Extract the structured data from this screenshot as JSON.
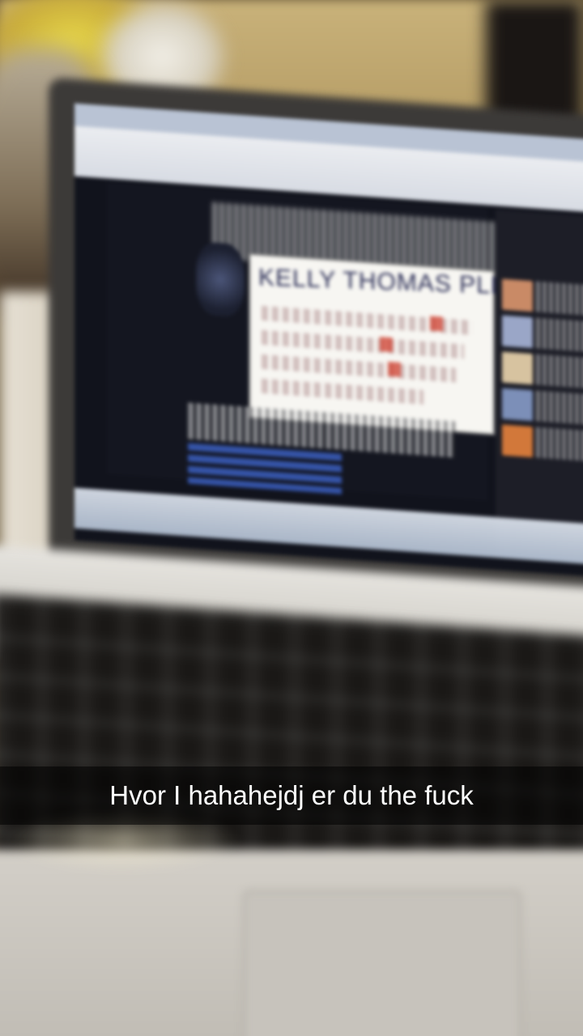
{
  "caption": {
    "text": "Hvor I hahahejdj er du the fuck"
  },
  "screen": {
    "whiteboard_title": "KELLY THOMAS PLEAS"
  },
  "colors": {
    "caption_background": "#000000",
    "caption_text": "#ffffff",
    "screen_background": "#11131c",
    "link_blue": "#3d63c9"
  }
}
